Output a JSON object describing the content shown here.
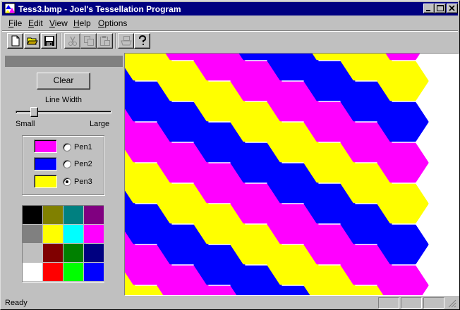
{
  "window": {
    "title": "Tess3.bmp - Joel's Tessellation Program",
    "buttons": [
      "minimize-icon",
      "maximize-icon",
      "close-icon"
    ]
  },
  "menu": [
    {
      "label": "File",
      "accel": "F",
      "rest": "ile"
    },
    {
      "label": "Edit",
      "accel": "E",
      "rest": "dit"
    },
    {
      "label": "View",
      "accel": "V",
      "rest": "iew"
    },
    {
      "label": "Help",
      "accel": "H",
      "rest": "elp"
    },
    {
      "label": "Options",
      "accel": "O",
      "rest": "ptions"
    }
  ],
  "toolbar": {
    "tools": [
      {
        "icon": "new-file-icon",
        "enabled": true
      },
      {
        "icon": "open-folder-icon",
        "enabled": true
      },
      {
        "icon": "save-disk-icon",
        "enabled": true
      },
      {
        "icon": "cut-icon",
        "enabled": false
      },
      {
        "icon": "copy-icon",
        "enabled": false
      },
      {
        "icon": "paste-icon",
        "enabled": false
      },
      {
        "icon": "print-icon",
        "enabled": false
      },
      {
        "icon": "help-icon",
        "enabled": true
      }
    ]
  },
  "panel": {
    "clear_label": "Clear",
    "line_width_label": "Line Width",
    "small_label": "Small",
    "large_label": "Large",
    "line_width_level": 0.17,
    "pens": [
      {
        "label": "Pen1",
        "color": "#ff00ff",
        "selected": false
      },
      {
        "label": "Pen2",
        "color": "#0000ff",
        "selected": false
      },
      {
        "label": "Pen3",
        "color": "#ffff00",
        "selected": true
      }
    ],
    "palette": [
      "#000000",
      "#808000",
      "#008080",
      "#800080",
      "#808080",
      "#ffff00",
      "#00ffff",
      "#ff00ff",
      "#c0c0c0",
      "#800000",
      "#008000",
      "#000080",
      "#ffffff",
      "#ff0000",
      "#00ff00",
      "#0000ff"
    ]
  },
  "canvas": {
    "pattern": "hexagon-tessellation",
    "colors": [
      "#ffff00",
      "#0000ff",
      "#ff00ff"
    ]
  },
  "status": {
    "text": "Ready"
  }
}
